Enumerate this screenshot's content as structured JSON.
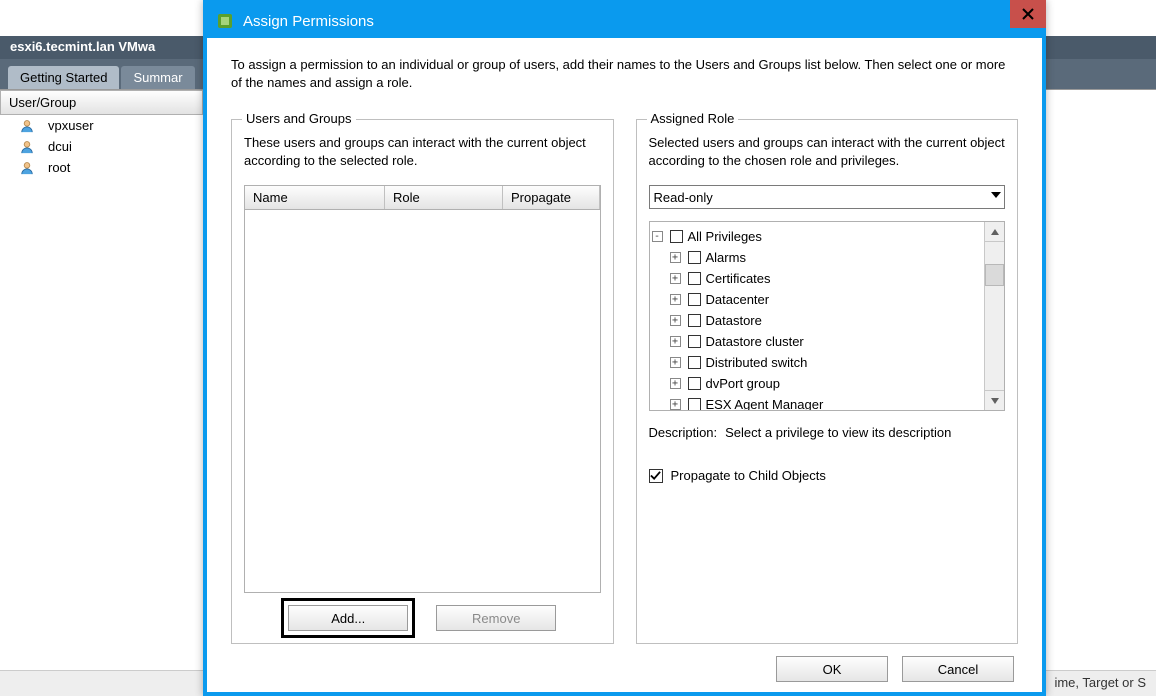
{
  "bg": {
    "title": "esxi6.tecmint.lan VMwa",
    "tabs": {
      "t0": "Getting Started",
      "t1": "Summar"
    },
    "col_header": "User/Group",
    "users": [
      "vpxuser",
      "dcui",
      "root"
    ],
    "footer_hint": "ime, Target or S"
  },
  "dialog": {
    "title": "Assign Permissions",
    "instruction": "To assign a permission to an individual or group of users, add their names to the Users and Groups list below. Then select one or more of the names and assign a role.",
    "users_groups": {
      "legend": "Users and Groups",
      "desc": "These users and groups can interact with the current object according to the selected role.",
      "cols": {
        "name": "Name",
        "role": "Role",
        "prop": "Propagate"
      },
      "add": "Add...",
      "remove": "Remove"
    },
    "assigned_role": {
      "legend": "Assigned Role",
      "desc": "Selected users and groups can interact with the current object according to the chosen role and privileges.",
      "role": "Read-only",
      "privileges_root": "All Privileges",
      "privileges": [
        "Alarms",
        "Certificates",
        "Datacenter",
        "Datastore",
        "Datastore cluster",
        "Distributed switch",
        "dvPort group",
        "ESX Agent Manager"
      ],
      "desc_label": "Description:",
      "desc_text": "Select a privilege to view its description",
      "propagate": "Propagate to Child Objects"
    },
    "buttons": {
      "ok": "OK",
      "cancel": "Cancel"
    }
  }
}
